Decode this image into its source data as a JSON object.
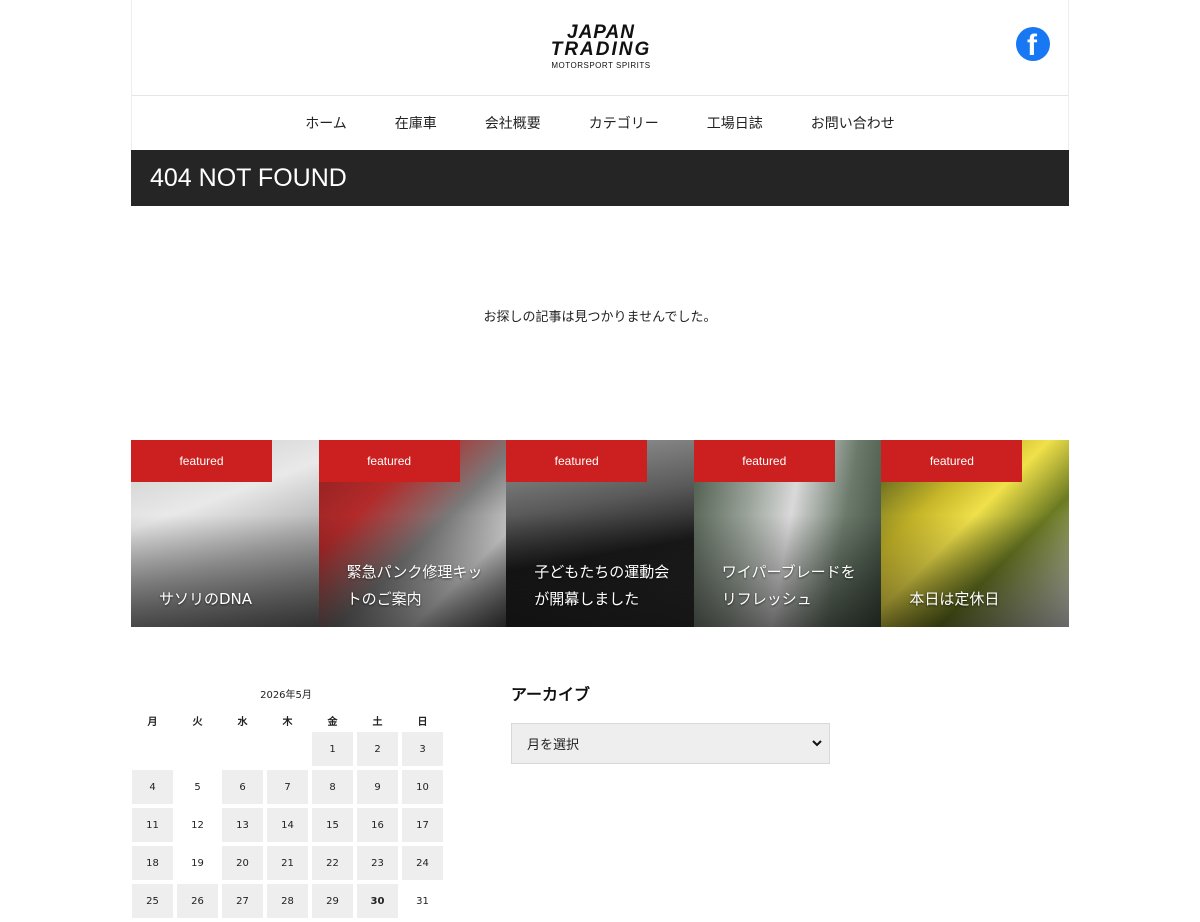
{
  "header": {
    "logo_line1": "JAPAN",
    "logo_line2": "TRADING",
    "logo_sub": "MOTORSPORT SPIRITS",
    "facebook_icon": "facebook-icon",
    "facebook_color": "#1877f2"
  },
  "nav": {
    "items": [
      "ホーム",
      "在庫車",
      "会社概要",
      "カテゴリー",
      "工場日誌",
      "お問い合わせ"
    ]
  },
  "page": {
    "title": "404 NOT FOUND",
    "message": "お探しの記事は見つかりませんでした。"
  },
  "featured": {
    "tag_color": "#cc1f1f",
    "items": [
      {
        "tag": "featured",
        "caption": "サソリのDNA"
      },
      {
        "tag": "featured",
        "caption": "緊急パンク修理キットのご案内"
      },
      {
        "tag": "featured",
        "caption": "子どもたちの運動会が開幕しました"
      },
      {
        "tag": "featured",
        "caption": "ワイパーブレードをリフレッシュ"
      },
      {
        "tag": "featured",
        "caption": "本日は定休日"
      }
    ]
  },
  "calendar": {
    "caption": "2026年5月",
    "weekdays": [
      "月",
      "火",
      "水",
      "木",
      "金",
      "土",
      "日"
    ],
    "rows": [
      [
        "",
        "",
        "",
        "",
        "1",
        "2",
        "3"
      ],
      [
        "4",
        "5",
        "6",
        "7",
        "8",
        "9",
        "10"
      ],
      [
        "11",
        "12",
        "13",
        "14",
        "15",
        "16",
        "17"
      ],
      [
        "18",
        "19",
        "20",
        "21",
        "22",
        "23",
        "24"
      ],
      [
        "25",
        "26",
        "27",
        "28",
        "29",
        "30",
        "31"
      ]
    ]
  },
  "archive": {
    "heading": "アーカイブ",
    "select_value": "月を選択"
  }
}
